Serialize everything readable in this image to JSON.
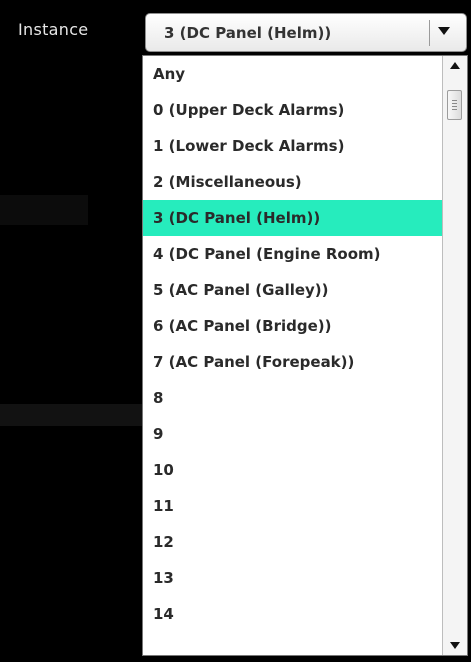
{
  "field": {
    "label": "Instance",
    "selected_value": "3 (DC Panel (Helm))"
  },
  "dropdown": {
    "selected_index": 4,
    "options": [
      "Any",
      "0 (Upper Deck Alarms)",
      "1 (Lower Deck Alarms)",
      "2 (Miscellaneous)",
      "3 (DC Panel (Helm))",
      "4 (DC Panel (Engine Room)",
      "5 (AC Panel (Galley))",
      "6 (AC Panel (Bridge))",
      "7 (AC Panel (Forepeak))",
      "8",
      "9",
      "10",
      "11",
      "12",
      "13",
      "14"
    ]
  },
  "colors": {
    "highlight": "#26ecbd",
    "background": "#000000"
  },
  "icons": {
    "dropdown": "chevron-down-icon",
    "scroll_up": "scroll-up-arrow-icon",
    "scroll_down": "scroll-down-arrow-icon"
  }
}
